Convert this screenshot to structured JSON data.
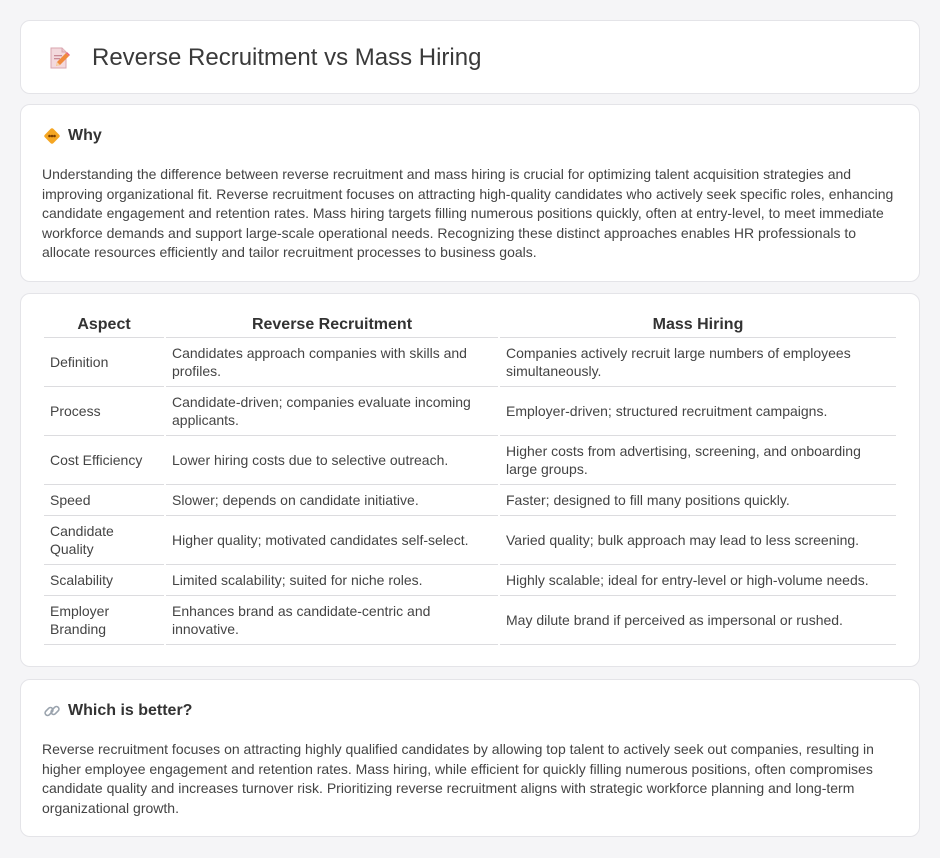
{
  "page": {
    "title": "Reverse Recruitment vs Mass Hiring",
    "title_icon": "document-pencil-icon"
  },
  "why": {
    "icon": "diamond-signal-icon",
    "heading": "Why",
    "body": "Understanding the difference between reverse recruitment and mass hiring is crucial for optimizing talent acquisition strategies and improving organizational fit. Reverse recruitment focuses on attracting high-quality candidates who actively seek specific roles, enhancing candidate engagement and retention rates. Mass hiring targets filling numerous positions quickly, often at entry-level, to meet immediate workforce demands and support large-scale operational needs. Recognizing these distinct approaches enables HR professionals to allocate resources efficiently and tailor recruitment processes to business goals."
  },
  "table": {
    "headers": [
      "Aspect",
      "Reverse Recruitment",
      "Mass Hiring"
    ],
    "rows": [
      [
        "Definition",
        "Candidates approach companies with skills and profiles.",
        "Companies actively recruit large numbers of employees simultaneously."
      ],
      [
        "Process",
        "Candidate-driven; companies evaluate incoming applicants.",
        "Employer-driven; structured recruitment campaigns."
      ],
      [
        "Cost Efficiency",
        "Lower hiring costs due to selective outreach.",
        "Higher costs from advertising, screening, and onboarding large groups."
      ],
      [
        "Speed",
        "Slower; depends on candidate initiative.",
        "Faster; designed to fill many positions quickly."
      ],
      [
        "Candidate Quality",
        "Higher quality; motivated candidates self-select.",
        "Varied quality; bulk approach may lead to less screening."
      ],
      [
        "Scalability",
        "Limited scalability; suited for niche roles.",
        "Highly scalable; ideal for entry-level or high-volume needs."
      ],
      [
        "Employer Branding",
        "Enhances brand as candidate-centric and innovative.",
        "May dilute brand if perceived as impersonal or rushed."
      ]
    ]
  },
  "better": {
    "icon": "link-icon",
    "heading": "Which is better?",
    "body": "Reverse recruitment focuses on attracting highly qualified candidates by allowing top talent to actively seek out companies, resulting in higher employee engagement and retention rates. Mass hiring, while efficient for quickly filling numerous positions, often compromises candidate quality and increases turnover risk. Prioritizing reverse recruitment aligns with strategic workforce planning and long-term organizational growth."
  },
  "colors": {
    "background": "#f5f5f7",
    "card": "#ffffff",
    "accent_orange": "#f0a030",
    "icon_pink": "#e8607a"
  }
}
